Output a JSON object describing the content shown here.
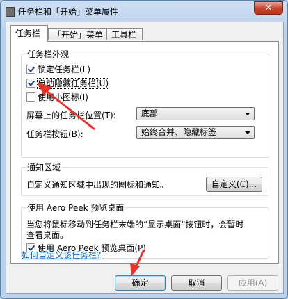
{
  "window": {
    "title": "任务栏和「开始」菜单属性",
    "close_label": "✕"
  },
  "tabs": [
    {
      "label": "任务栏",
      "active": true
    },
    {
      "label": "「开始」菜单",
      "active": false
    },
    {
      "label": "工具栏",
      "active": false
    }
  ],
  "appearance": {
    "title": "任务栏外观",
    "lock": {
      "label": "锁定任务栏(L)",
      "checked": true
    },
    "autohide": {
      "label": "自动隐藏任务栏(U)",
      "checked": true
    },
    "small_icons": {
      "label": "使用小图标(I)",
      "checked": false
    },
    "location": {
      "label": "屏幕上的任务栏位置(T):",
      "value": "底部"
    },
    "buttons": {
      "label": "任务栏按钮(B):",
      "value": "始终合并、隐藏标签"
    }
  },
  "notification": {
    "title": "通知区域",
    "text": "自定义通知区域中出现的图标和通知。",
    "customize_label": "自定义(C)..."
  },
  "aero_peek": {
    "title": "使用 Aero Peek 预览桌面",
    "description_line1": "当您将鼠标移动到任务栏末端的“显示桌面”按钮时，会暂时",
    "description_line2": "查看桌面。",
    "checkbox": {
      "label": "使用 Aero Peek 预览桌面(P)",
      "checked": true
    }
  },
  "help_link": "如何自定义该任务栏?",
  "buttons": {
    "ok": "确定",
    "cancel": "取消",
    "apply": "应用(A)"
  },
  "colors": {
    "annotation_arrow": "#e8322a",
    "link": "#0066cc"
  }
}
